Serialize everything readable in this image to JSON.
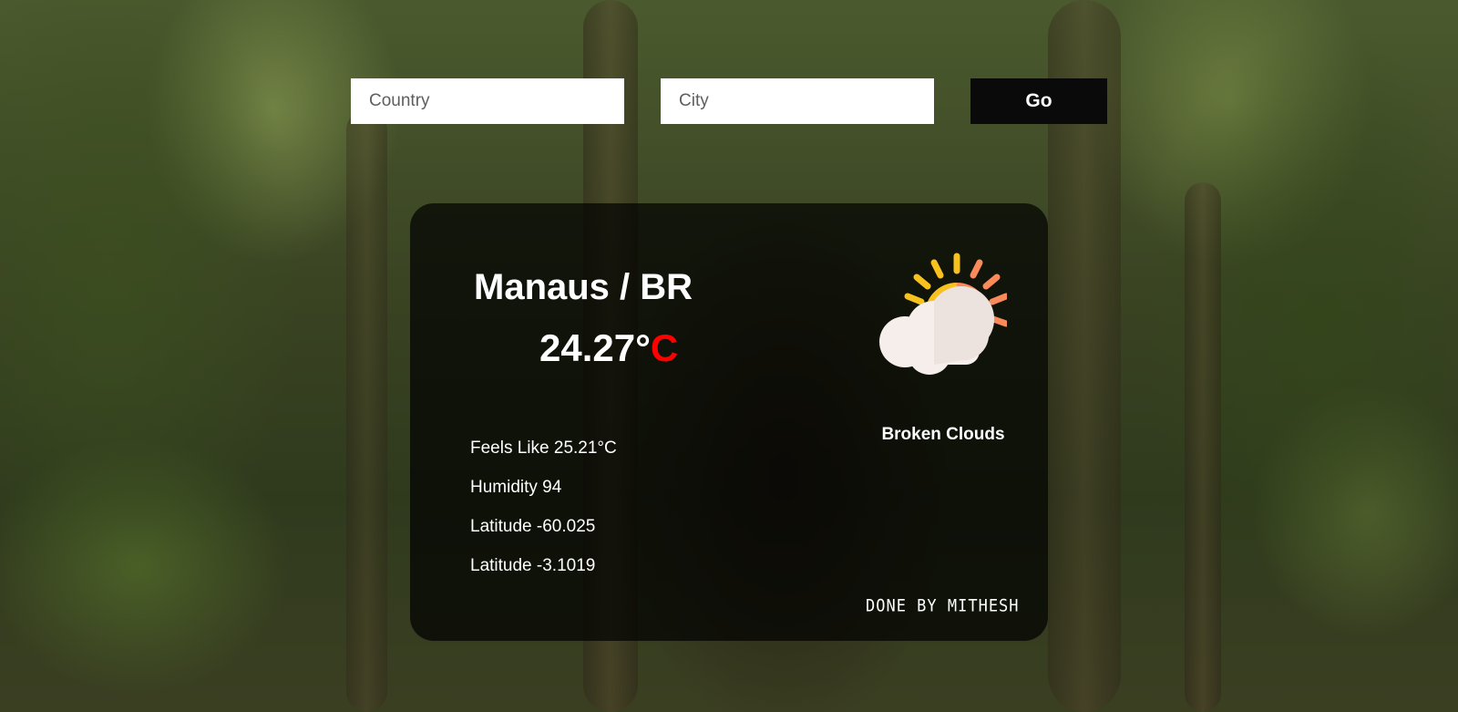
{
  "search": {
    "country_placeholder": "Country",
    "city_placeholder": "City",
    "go_label": "Go"
  },
  "weather": {
    "location": "Manaus / BR",
    "temperature_value": "24.27°",
    "temperature_unit": "C",
    "condition": "Broken Clouds",
    "icon": "sun-behind-cloud-icon",
    "details": [
      "Feels Like 25.21°C",
      "Humidity 94",
      "Latitude -60.025",
      "Latitude -3.1019"
    ]
  },
  "footer": {
    "credit": "DONE BY MITHESH"
  },
  "colors": {
    "unit_accent": "#ff0000",
    "sun": "#f7c21e",
    "sun_shade": "#fb8a5a",
    "cloud": "#f5eeeb"
  }
}
